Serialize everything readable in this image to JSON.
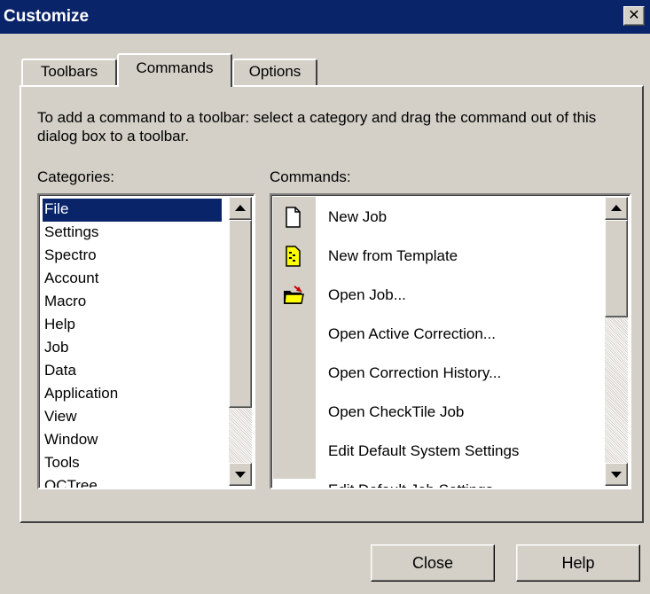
{
  "window": {
    "title": "Customize",
    "close_glyph": "✕"
  },
  "tabs": [
    {
      "label": "Toolbars",
      "active": false
    },
    {
      "label": "Commands",
      "active": true
    },
    {
      "label": "Options",
      "active": false
    }
  ],
  "commands_tab": {
    "instructions": "To add a command to a toolbar: select a category and drag the command out of this dialog  box to a toolbar.",
    "categories_label": "Categories:",
    "commands_label": "Commands:",
    "categories": [
      "File",
      "Settings",
      "Spectro",
      "Account",
      "Macro",
      "Help",
      "Job",
      "Data",
      "Application",
      "View",
      "Window",
      "Tools",
      "QCTree"
    ],
    "selected_category": "File",
    "commands": [
      {
        "label": "New Job",
        "icon": "new-document-icon"
      },
      {
        "label": "New from Template",
        "icon": "template-document-icon"
      },
      {
        "label": "Open Job...",
        "icon": "open-folder-icon"
      },
      {
        "label": "Open Active Correction...",
        "icon": ""
      },
      {
        "label": "Open Correction History...",
        "icon": ""
      },
      {
        "label": "Open CheckTile Job",
        "icon": ""
      },
      {
        "label": "Edit Default System Settings",
        "icon": ""
      },
      {
        "label": "Edit Default Job Settings",
        "icon": ""
      }
    ]
  },
  "buttons": {
    "close_label": "Close",
    "help_label": "Help"
  },
  "colors": {
    "titlebar": "#0a246a",
    "face": "#d4d0c8",
    "selection": "#0a246a"
  }
}
